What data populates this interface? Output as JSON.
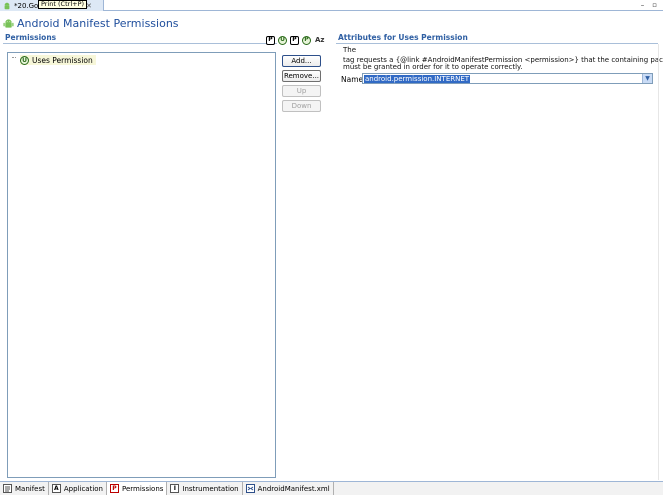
{
  "editor_tab": {
    "label": "*20.Go",
    "label_tail": "est",
    "tooltip": "Print (Ctrl+P)"
  },
  "window_controls": {
    "minimize": "–",
    "maximize": "▫"
  },
  "header": {
    "title": "Android Manifest Permissions"
  },
  "permissions_section": {
    "title": "Permissions",
    "toolbar": {
      "permission": "P",
      "uses_permission": "U",
      "permission_tree": "P",
      "permission_group": "P",
      "sort": "Az"
    },
    "tree_items": [
      {
        "icon": "U",
        "label": "Uses Permission"
      }
    ],
    "buttons": {
      "add": "Add...",
      "remove": "Remove...",
      "up": "Up",
      "down": "Down"
    }
  },
  "attributes_section": {
    "title": "Attributes for Uses Permission",
    "description_line1": "The",
    "description_line2": "tag requests a {@link #AndroidManifestPermission <permission>} that the containing package",
    "description_line3": "must be granted in order for it to operate correctly.",
    "name_label": "Name",
    "name_value": "android.permission.INTERNET"
  },
  "bottom_tabs": [
    {
      "label": "Manifest",
      "icon": ""
    },
    {
      "label": "Application",
      "icon": "A"
    },
    {
      "label": "Permissions",
      "icon": "P"
    },
    {
      "label": "Instrumentation",
      "icon": "I"
    },
    {
      "label": "AndroidManifest.xml",
      "icon": ""
    }
  ],
  "colors": {
    "title_blue": "#1f4e9c",
    "section_blue": "#2f5fa3",
    "selection": "#316ac5",
    "android_green": "#78c257"
  }
}
